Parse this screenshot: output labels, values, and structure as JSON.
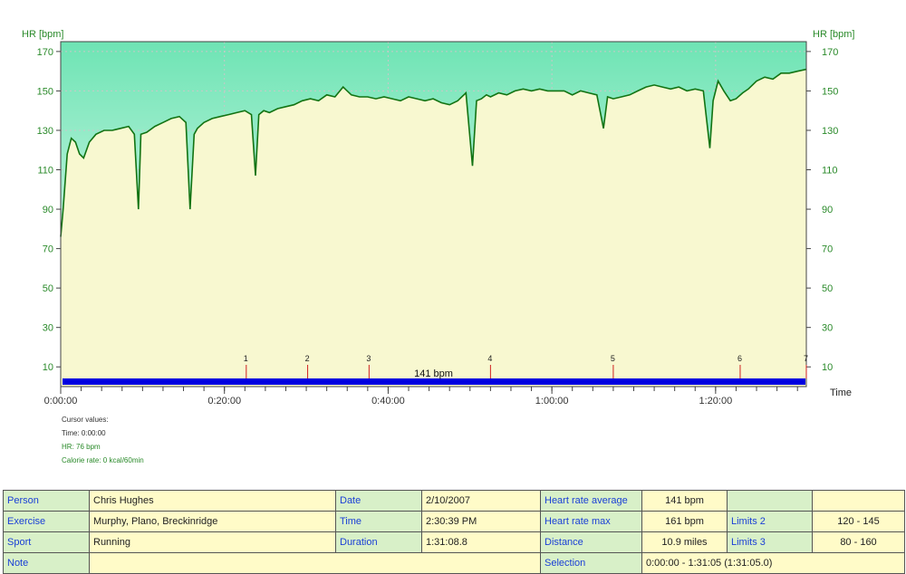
{
  "colors": {
    "hr_line": "#137313",
    "plot_bg_upper": "#6ee4b4",
    "plot_bg_lower": "#f8f8d0",
    "marker": "#d02020",
    "bar": "#0000e0",
    "label_cell": "#d8f0c8",
    "value_cell": "#fffbc8",
    "label_text": "#1a3fd6"
  },
  "chart_data": {
    "type": "line",
    "ylabel_left": "HR [bpm]",
    "ylabel_right": "HR [bpm]",
    "xlabel": "Time",
    "ylim": [
      0,
      175
    ],
    "yticks": [
      10,
      30,
      50,
      70,
      90,
      110,
      130,
      150,
      170
    ],
    "xlim": [
      "0:00:00",
      "1:31:05"
    ],
    "xticks": [
      "0:00:00",
      "0:20:00",
      "0:40:00",
      "1:00:00",
      "1:20:00"
    ],
    "bar_label": "141 bpm",
    "lap_markers": [
      {
        "label": "1",
        "t": "0:22:40"
      },
      {
        "label": "2",
        "t": "0:30:10"
      },
      {
        "label": "3",
        "t": "0:37:40"
      },
      {
        "label": "4",
        "t": "0:52:30"
      },
      {
        "label": "5",
        "t": "1:07:30"
      },
      {
        "label": "6",
        "t": "1:23:00"
      },
      {
        "label": "7",
        "t": "1:31:05"
      }
    ],
    "series": [
      {
        "x_minutes": [
          0,
          0.3,
          0.8,
          1.3,
          1.8,
          2.3,
          2.8,
          3.5,
          4.3,
          5.3,
          6.3,
          7.3,
          8.3,
          9.0,
          9.5,
          9.8,
          10.5,
          11.5,
          12.5,
          13.5,
          14.5,
          15.3,
          15.8,
          16.3,
          16.7,
          17.5,
          18.5,
          19.5,
          20.5,
          21.5,
          22.5,
          23.3,
          23.8,
          24.2,
          24.8,
          25.5,
          26.5,
          27.5,
          28.5,
          29.5,
          30.5,
          31.5,
          32.5,
          33.5,
          34.5,
          35.5,
          36.5,
          37.5,
          38.5,
          39.5,
          40.5,
          41.5,
          42.5,
          43.5,
          44.5,
          45.5,
          46.5,
          47.5,
          48.5,
          49.5,
          50.3,
          50.8,
          51.4,
          52.0,
          52.5,
          53.5,
          54.5,
          55.5,
          56.5,
          57.5,
          58.5,
          59.5,
          60.5,
          61.5,
          62.5,
          63.5,
          64.5,
          65.5,
          66.3,
          66.8,
          67.5,
          68.5,
          69.5,
          70.5,
          71.5,
          72.5,
          73.5,
          74.5,
          75.5,
          76.5,
          77.5,
          78.5,
          79.3,
          79.7,
          80.3,
          81.0,
          81.8,
          82.5,
          83.3,
          84.0,
          85.0,
          86.0,
          87.0,
          88.0,
          89.0,
          90.0,
          91.08
        ],
        "y": [
          76,
          90,
          118,
          126,
          124,
          118,
          116,
          124,
          128,
          130,
          130,
          131,
          132,
          128,
          90,
          128,
          129,
          132,
          134,
          136,
          137,
          134,
          90,
          128,
          131,
          134,
          136,
          137,
          138,
          139,
          140,
          138,
          107,
          138,
          140,
          139,
          141,
          142,
          143,
          145,
          146,
          145,
          148,
          147,
          152,
          148,
          147,
          147,
          146,
          147,
          146,
          145,
          147,
          146,
          145,
          146,
          144,
          143,
          145,
          149,
          112,
          145,
          146,
          148,
          147,
          149,
          148,
          150,
          151,
          150,
          151,
          150,
          150,
          150,
          148,
          150,
          149,
          148,
          131,
          147,
          146,
          147,
          148,
          150,
          152,
          153,
          152,
          151,
          152,
          150,
          151,
          150,
          121,
          145,
          155,
          150,
          145,
          146,
          149,
          151,
          155,
          157,
          156,
          159,
          159,
          160,
          161
        ]
      }
    ]
  },
  "cursor": {
    "title": "Cursor values:",
    "time": "Time: 0:00:00",
    "hr": "HR: 76 bpm",
    "calorie": "Calorie rate: 0 kcal/60min"
  },
  "info": {
    "person_label": "Person",
    "person": "Chris Hughes",
    "exercise_label": "Exercise",
    "exercise": "Murphy, Plano, Breckinridge",
    "sport_label": "Sport",
    "sport": "Running",
    "note_label": "Note",
    "note": "",
    "date_label": "Date",
    "date": "2/10/2007",
    "time_label": "Time",
    "time": "2:30:39 PM",
    "duration_label": "Duration",
    "duration": "1:31:08.8",
    "hr_avg_label": "Heart rate average",
    "hr_avg": "141 bpm",
    "hr_max_label": "Heart rate max",
    "hr_max": "161 bpm",
    "distance_label": "Distance",
    "distance": "10.9 miles",
    "selection_label": "Selection",
    "selection": "0:00:00 - 1:31:05 (1:31:05.0)",
    "limits2_label": "Limits 2",
    "limits2": "120 - 145",
    "limits3_label": "Limits 3",
    "limits3": "80 - 160",
    "row1_extra_label": "",
    "row1_extra": ""
  }
}
